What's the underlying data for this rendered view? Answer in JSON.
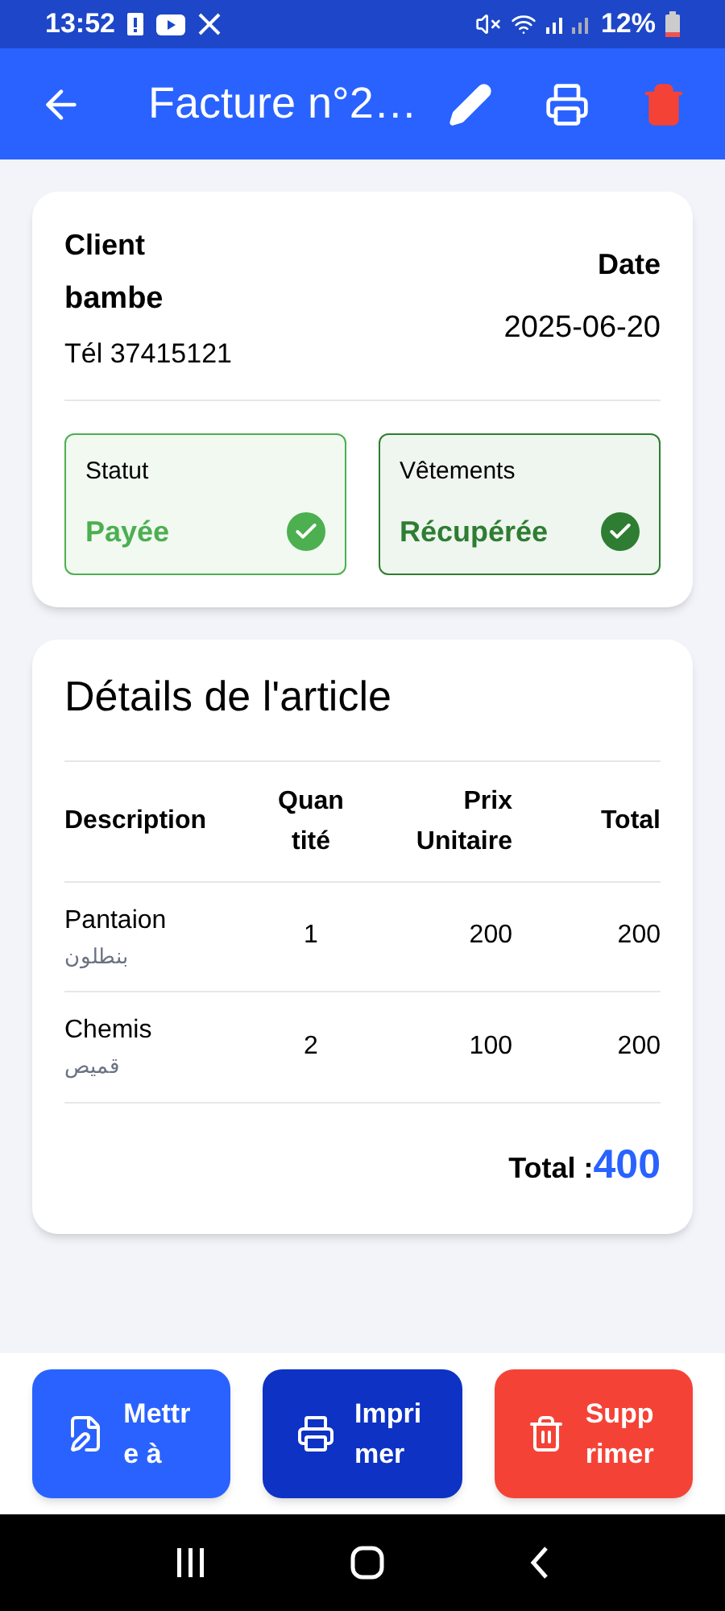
{
  "status_bar": {
    "time": "13:52",
    "battery": "12%"
  },
  "app_bar": {
    "title": "Facture n°2…"
  },
  "client": {
    "label": "Client",
    "name": "bambe",
    "phone": "Tél 37415121"
  },
  "date": {
    "label": "Date",
    "value": "2025-06-20"
  },
  "statuses": [
    {
      "label": "Statut",
      "value": "Payée",
      "checked": true,
      "color": "#4caf50"
    },
    {
      "label": "Vêtements",
      "value": "Récupérée",
      "checked": true,
      "color": "#2e7d32"
    }
  ],
  "details": {
    "title": "Détails de l'article",
    "columns": [
      "Description",
      "Quantité",
      "Prix Unitaire",
      "Total"
    ],
    "rows": [
      {
        "name": "Pantaion",
        "arabic": "بنطلون",
        "qty": "1",
        "price": "200",
        "total": "200"
      },
      {
        "name": "Chemis",
        "arabic": "قميص",
        "qty": "2",
        "price": "100",
        "total": "200"
      }
    ],
    "total_label": "Total :",
    "total_value": "400"
  },
  "actions": [
    {
      "kind": "edit",
      "label": "Mettre à"
    },
    {
      "kind": "print",
      "label": "Imprimer"
    },
    {
      "kind": "delete",
      "label": "Supprimer"
    }
  ]
}
